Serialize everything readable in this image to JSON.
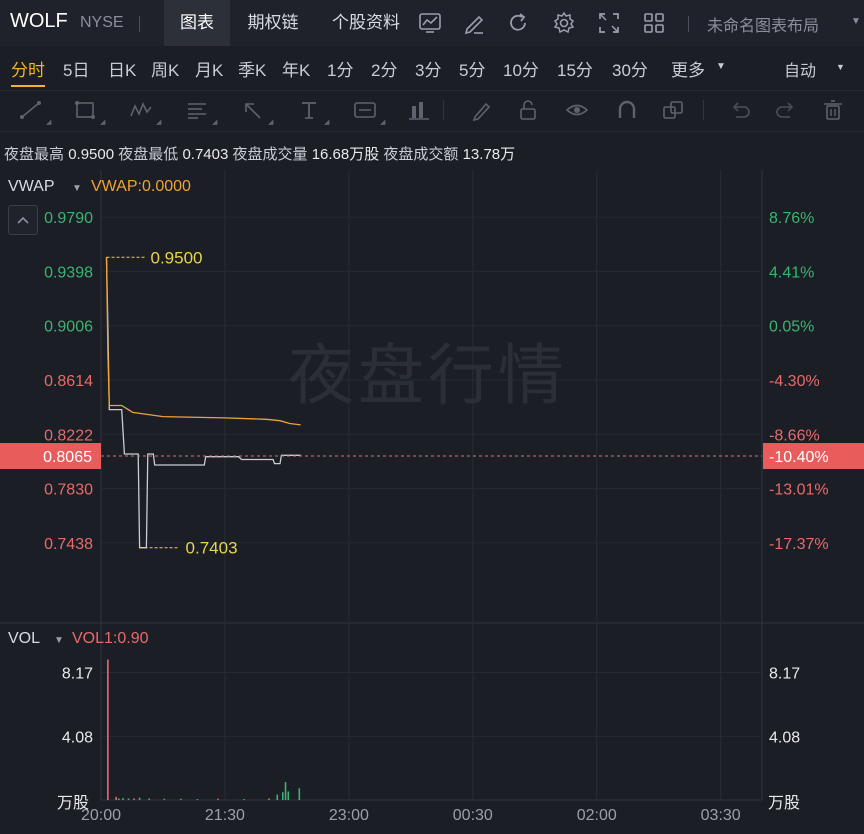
{
  "header": {
    "symbol": "WOLF",
    "exchange": "NYSE",
    "tabs": [
      {
        "label": "图表",
        "active": true
      },
      {
        "label": "期权链",
        "active": false
      },
      {
        "label": "个股资料",
        "active": false
      }
    ],
    "toolbar_icons": [
      "chart-type-icon",
      "draw-icon",
      "refresh-icon",
      "settings-icon",
      "fullscreen-icon",
      "grid-layout-icon"
    ],
    "layout_name": "未命名图表布局"
  },
  "periods": {
    "items": [
      "分时",
      "5日",
      "日K",
      "周K",
      "月K",
      "季K",
      "年K",
      "1分",
      "2分",
      "3分",
      "5分",
      "10分",
      "15分",
      "30分",
      "更多"
    ],
    "active": "分时",
    "scale_mode": "自动"
  },
  "draw_tools": [
    "line-tool-icon",
    "rectangle-tool-icon",
    "wave-tool-icon",
    "fib-tool-icon",
    "arrow-tool-icon",
    "text-tool-icon",
    "label-tool-icon",
    "measure-tool-icon",
    "pen-tool-icon",
    "lock-icon",
    "eye-icon",
    "magnet-icon",
    "layers-icon",
    "undo-icon",
    "redo-icon",
    "trash-icon"
  ],
  "stats": {
    "high_label": "夜盘最高",
    "high": "0.9500",
    "low_label": "夜盘最低",
    "low": "0.7403",
    "volume_label": "夜盘成交量",
    "volume": "16.68万股",
    "amount_label": "夜盘成交额",
    "amount": "13.78万"
  },
  "price_panel": {
    "indicator": "VWAP",
    "indicator_value": "VWAP:0.0000",
    "watermark": "夜盘行情",
    "left_ticks": [
      {
        "label": "0.9790",
        "value": 0.979,
        "color": "#3cb371"
      },
      {
        "label": "0.9398",
        "value": 0.9398,
        "color": "#3cb371"
      },
      {
        "label": "0.9006",
        "value": 0.9006,
        "color": "#3cb371"
      },
      {
        "label": "0.8614",
        "value": 0.8614,
        "color": "#e86a6a"
      },
      {
        "label": "0.8222",
        "value": 0.8222,
        "color": "#e86a6a"
      },
      {
        "label": "0.7830",
        "value": 0.783,
        "color": "#e86a6a"
      },
      {
        "label": "0.7438",
        "value": 0.7438,
        "color": "#e86a6a"
      }
    ],
    "right_ticks": [
      {
        "label": "8.76%",
        "value": 0.979,
        "color": "#3cb371"
      },
      {
        "label": "4.41%",
        "value": 0.9398,
        "color": "#3cb371"
      },
      {
        "label": "0.05%",
        "value": 0.9006,
        "color": "#3cb371"
      },
      {
        "label": "-4.30%",
        "value": 0.8614,
        "color": "#e86a6a"
      },
      {
        "label": "-8.66%",
        "value": 0.8222,
        "color": "#e86a6a"
      },
      {
        "label": "-13.01%",
        "value": 0.783,
        "color": "#e86a6a"
      },
      {
        "label": "-17.37%",
        "value": 0.7438,
        "color": "#e86a6a"
      }
    ],
    "current_price": "0.8065",
    "current_change": "-10.40%",
    "high_marker": "0.9500",
    "low_marker": "0.7403"
  },
  "volume_panel": {
    "indicator": "VOL",
    "indicator_value": "VOL1:0.90",
    "left_ticks": [
      "8.17",
      "4.08"
    ],
    "right_ticks": [
      "8.17",
      "4.08"
    ],
    "unit_left": "万股",
    "unit_right": "万股"
  },
  "x_axis": [
    "20:00",
    "21:30",
    "23:00",
    "00:30",
    "02:00",
    "03:30"
  ],
  "chart_data": {
    "type": "line",
    "x_axis_labels": [
      "20:00",
      "21:30",
      "23:00",
      "00:30",
      "02:00",
      "03:30"
    ],
    "ylim": [
      0.7242,
      0.9986
    ],
    "series": [
      {
        "name": "",
        "color": "#c9ccd3",
        "points": [
          [
            "20:04",
            0.95
          ],
          [
            "20:05",
            0.9
          ],
          [
            "20:06",
            0.84
          ],
          [
            "20:15",
            0.84
          ],
          [
            "20:17",
            0.808
          ],
          [
            "20:27",
            0.808
          ],
          [
            "20:28",
            0.7403
          ],
          [
            "20:33",
            0.7403
          ],
          [
            "20:34",
            0.808
          ],
          [
            "20:38",
            0.808
          ],
          [
            "20:39",
            0.8
          ],
          [
            "21:15",
            0.8
          ],
          [
            "21:16",
            0.806
          ],
          [
            "21:40",
            0.806
          ],
          [
            "21:42",
            0.804
          ],
          [
            "22:05",
            0.804
          ],
          [
            "22:06",
            0.801
          ],
          [
            "22:10",
            0.801
          ],
          [
            "22:11",
            0.807
          ],
          [
            "22:25",
            0.807
          ]
        ]
      },
      {
        "name": "VWAP",
        "color": "#f0a236",
        "points": [
          [
            "20:04",
            0.95
          ],
          [
            "20:05",
            0.88
          ],
          [
            "20:06",
            0.843
          ],
          [
            "20:15",
            0.843
          ],
          [
            "20:23",
            0.838
          ],
          [
            "20:45",
            0.835
          ],
          [
            "21:30",
            0.834
          ],
          [
            "22:00",
            0.833
          ],
          [
            "22:10",
            0.832
          ],
          [
            "22:17",
            0.83
          ],
          [
            "22:25",
            0.829
          ]
        ]
      }
    ],
    "volume": {
      "ylim": [
        0,
        10
      ],
      "bars": [
        {
          "t": "20:05",
          "v": 9.0,
          "color": "#e86a6a"
        },
        {
          "t": "20:11",
          "v": 0.2,
          "color": "#e86a6a"
        },
        {
          "t": "20:13",
          "v": 0.1,
          "color": "#3cb371"
        },
        {
          "t": "20:16",
          "v": 0.12,
          "color": "#3cb371"
        },
        {
          "t": "20:20",
          "v": 0.1,
          "color": "#3cb371"
        },
        {
          "t": "20:24",
          "v": 0.1,
          "color": "#e86a6a"
        },
        {
          "t": "20:28",
          "v": 0.15,
          "color": "#3cb371"
        },
        {
          "t": "20:35",
          "v": 0.1,
          "color": "#3cb371"
        },
        {
          "t": "20:46",
          "v": 0.08,
          "color": "#3cb371"
        },
        {
          "t": "20:58",
          "v": 0.08,
          "color": "#3cb371"
        },
        {
          "t": "21:10",
          "v": 0.06,
          "color": "#3cb371"
        },
        {
          "t": "21:25",
          "v": 0.08,
          "color": "#e86a6a"
        },
        {
          "t": "21:44",
          "v": 0.06,
          "color": "#3cb371"
        },
        {
          "t": "22:02",
          "v": 0.1,
          "color": "#e86a6a"
        },
        {
          "t": "22:08",
          "v": 0.35,
          "color": "#3cb371"
        },
        {
          "t": "22:12",
          "v": 0.5,
          "color": "#3cb371"
        },
        {
          "t": "22:14",
          "v": 1.15,
          "color": "#3cb371"
        },
        {
          "t": "22:16",
          "v": 0.55,
          "color": "#3cb371"
        },
        {
          "t": "22:24",
          "v": 0.75,
          "color": "#3cb371"
        }
      ]
    }
  }
}
